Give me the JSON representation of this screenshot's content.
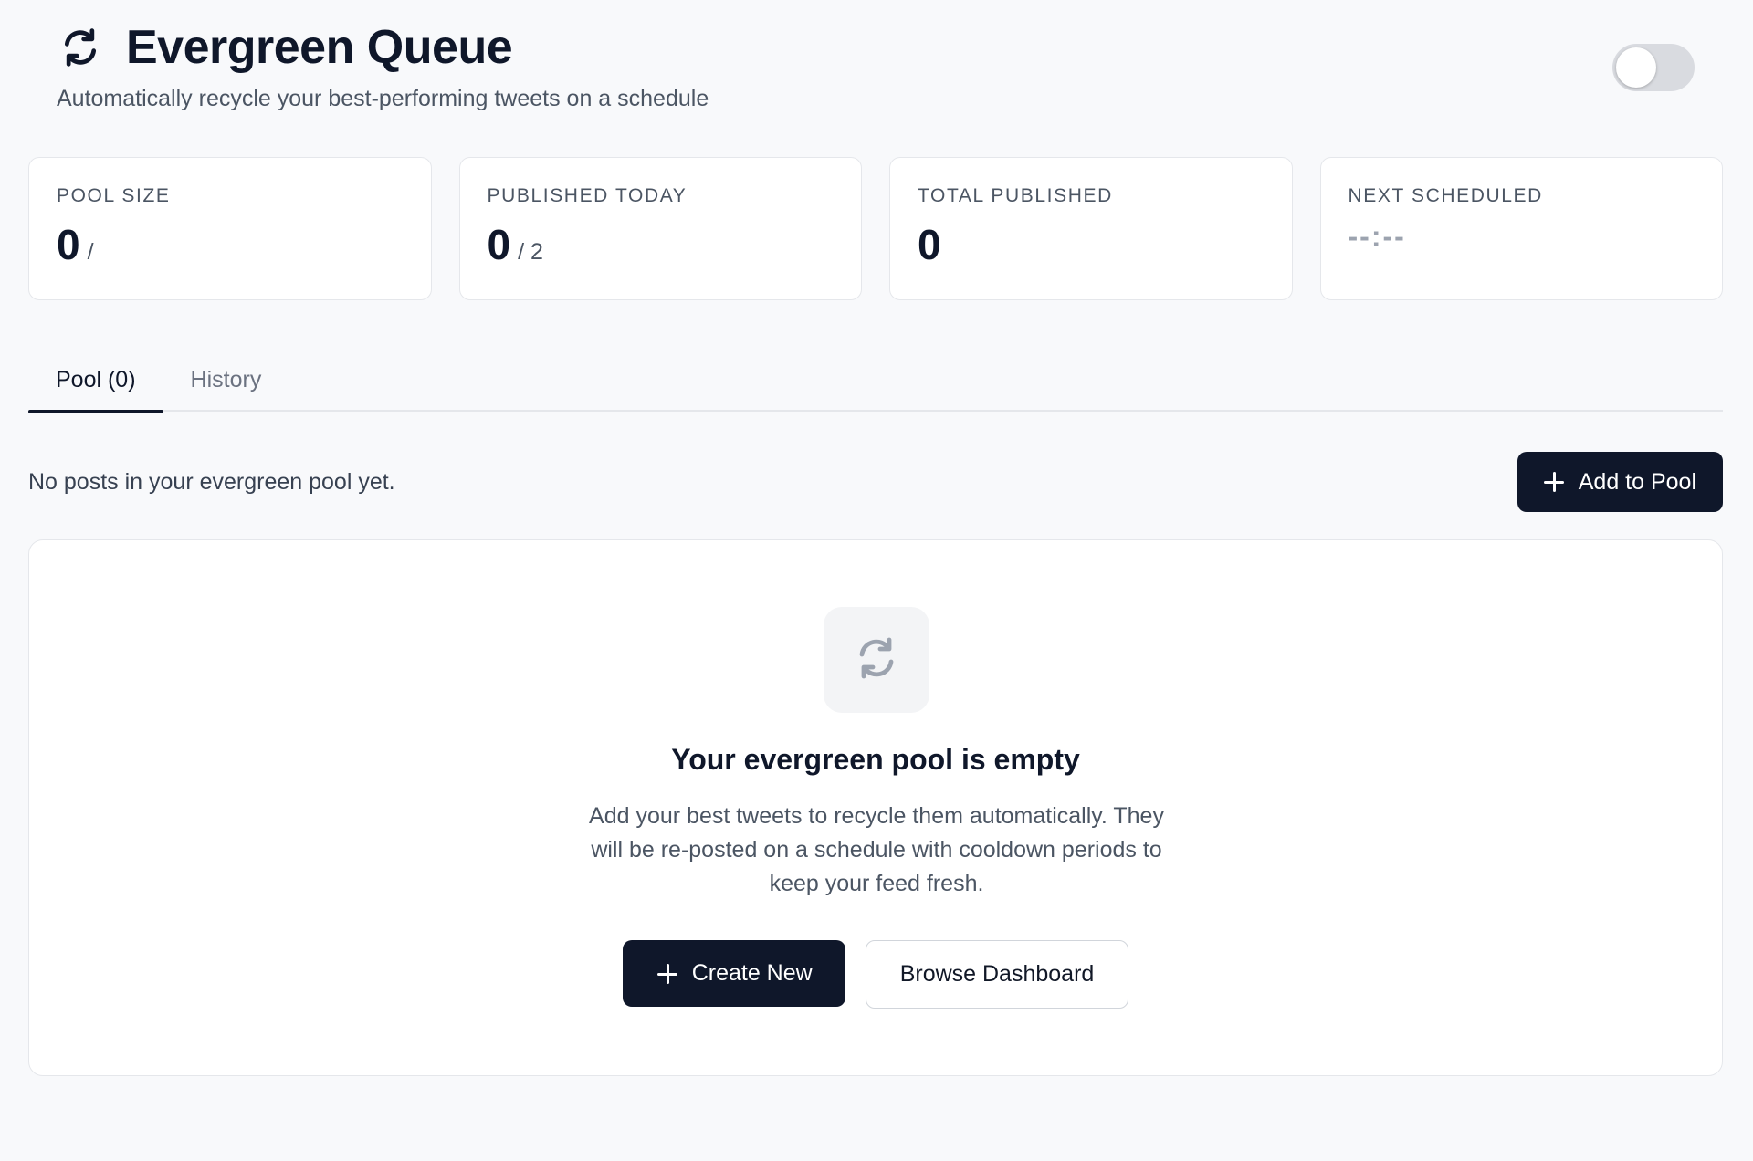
{
  "header": {
    "title": "Evergreen Queue",
    "subtitle": "Automatically recycle your best-performing tweets on a schedule",
    "icon": "refresh-icon",
    "toggle_on": false
  },
  "stats": [
    {
      "label": "POOL SIZE",
      "value": "0",
      "suffix": "/"
    },
    {
      "label": "PUBLISHED TODAY",
      "value": "0",
      "suffix": "/ 2"
    },
    {
      "label": "TOTAL PUBLISHED",
      "value": "0",
      "suffix": ""
    },
    {
      "label": "NEXT SCHEDULED",
      "value": "--:--",
      "suffix": ""
    }
  ],
  "tabs": [
    {
      "label": "Pool (0)",
      "active": true
    },
    {
      "label": "History",
      "active": false
    }
  ],
  "pool": {
    "status_text": "No posts in your evergreen pool yet.",
    "add_button_label": "Add to Pool"
  },
  "empty_state": {
    "icon": "refresh-icon",
    "title": "Your evergreen pool is empty",
    "description": "Add your best tweets to recycle them automatically. They will be re-posted on a schedule with cooldown periods to keep your feed fresh.",
    "create_button_label": "Create New",
    "browse_button_label": "Browse Dashboard"
  },
  "colors": {
    "primary": "#0f172a",
    "background": "#f8f9fb",
    "border": "#e5e7eb",
    "muted_text": "#4b5563"
  }
}
